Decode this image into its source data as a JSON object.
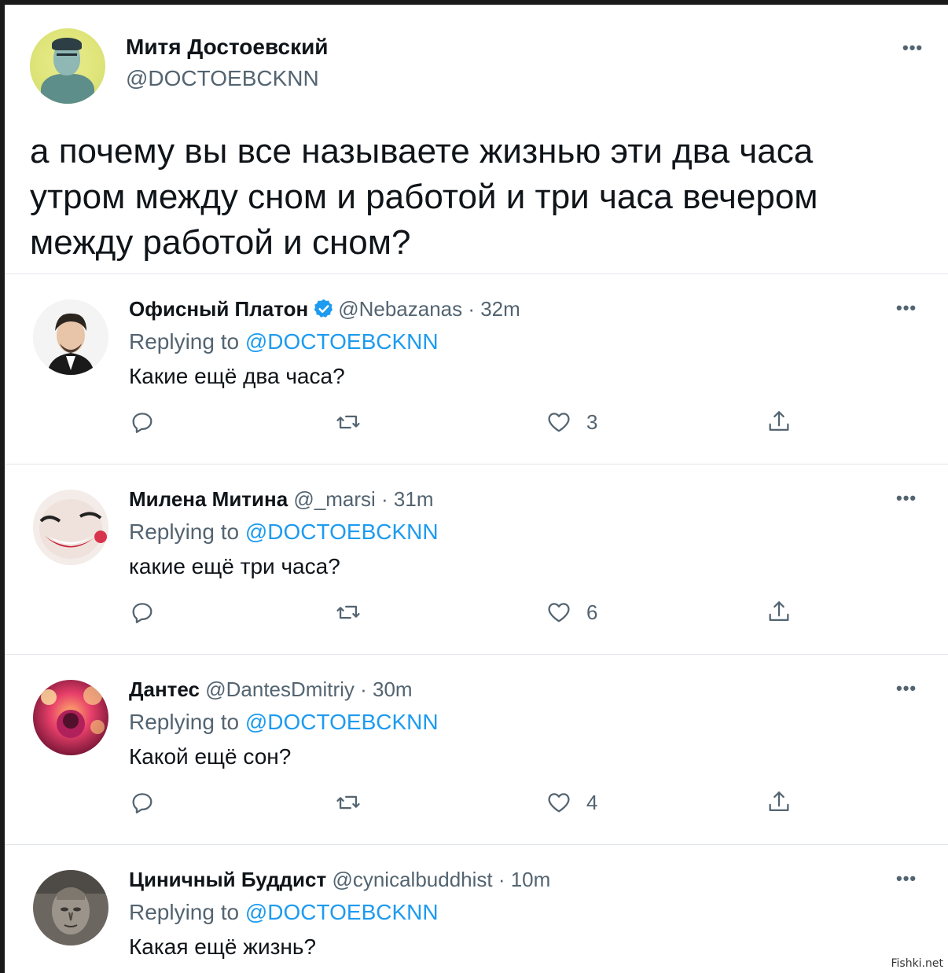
{
  "main": {
    "name": "Митя Достоевский",
    "handle": "@DOCTOEBCKNN",
    "more_icon": "more-icon",
    "text": "а почему вы все называете жизнью эти два часа утром между сном и работой и три часа вечером между работой и сном?"
  },
  "replies": [
    {
      "name": "Офисный Платон",
      "verified": true,
      "meta": "@Nebazanas · 32m",
      "replying_prefix": "Replying to ",
      "replying_handle": "@DOCTOEBCKNN",
      "text": "Какие ещё два часа?",
      "likes": "3"
    },
    {
      "name": "Милена Митина",
      "verified": false,
      "meta": "@_marsi · 31m",
      "replying_prefix": "Replying to ",
      "replying_handle": "@DOCTOEBCKNN",
      "text": "какие ещё три часа?",
      "likes": "6"
    },
    {
      "name": "Дантес",
      "verified": false,
      "meta": "@DantesDmitriy · 30m",
      "replying_prefix": "Replying to ",
      "replying_handle": "@DOCTOEBCKNN",
      "text": "Какой ещё сон?",
      "likes": "4"
    },
    {
      "name": "Циничный Буддист",
      "verified": false,
      "meta": "@cynicalbuddhist · 10m",
      "replying_prefix": "Replying to ",
      "replying_handle": "@DOCTOEBCKNN",
      "text": "Какая ещё жизнь?"
    }
  ],
  "icons": {
    "reply": "reply-icon",
    "retweet": "retweet-icon",
    "like": "heart-icon",
    "share": "share-icon",
    "verified": "verified-badge-icon"
  },
  "colors": {
    "accent": "#1d9bf0",
    "secondary_text": "#536471",
    "primary_text": "#0f1419"
  },
  "watermark": "Fishki.net"
}
